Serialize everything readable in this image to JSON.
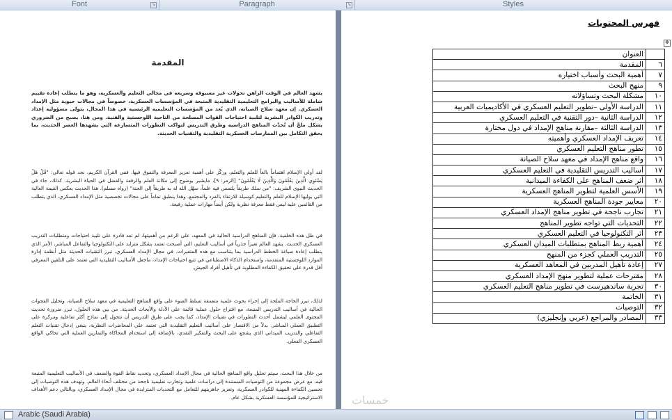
{
  "ribbon": {
    "groups": [
      "Font",
      "Paragraph",
      "Styles"
    ]
  },
  "document": {
    "title": "المقدمة",
    "paragraphs": [
      "يشهد العالم في الوقت الراهن تحولات غير مسبوقة وسريعة في مجالي التعليم والعسكرية، وهو ما يتطلب إعادة تقييم شاملة للأساليب والبرامج التعليمية التقليدية المتبعة في المؤسسات العسكرية، خصوصاً في مجالات حيوية مثل الإمداد العسكري. إن معهد سلاح الصيانة، الذي يُعد من المؤسسات التعليمية الرئيسية في هذا المجال، يتولى مسؤولية إعداد وتدريب الكوادر البشرية لتلبية احتياجات القوات المسلحة من الناحية اللوجستية والفنية. ومن هنا، يصبح من الضروري بشكل ملحّ أن تُحدّث المناهج الدراسية وطرق التدريس لتواكب التطورات المتسارعة التي يشهدها العصر الحديث، بما يحقق التكامل بين الممارسات العسكرية التقليدية والتقنيات الحديثة.",
      "لقد أولى الإسلام اهتماماً بالغاً للعلم والتعلم، وركّز على أهمية تعزيز المعرفة والتفوق فيها. ففي القرآن الكريم، نجد قوله تعالى: \"قُلْ هَلْ يَسْتَوِي الَّذِينَ يَعْلَمُونَ وَالَّذِينَ لَا يَعْلَمُونَ\" [الزمر: ٩]، مايشير بوضوح إلى مكانة العلم والرفعة والفضل في الحياة البشرية. كذلك، جاء في الحديث النبوي الشريف: \"من سلك طريقاً يلتمس فيه علماً، سهّل الله له به طريقاً إلى الجنة\" (رواه مسلم). هذا الحديث يعكس القيمة العالية التي يوليها الإسلام للعلم والتعليم كوسيلة للارتقاء بالفرد والمجتمع. وهذا ينطبق تماماً على مجالات تخصصية مثل الإمداد العسكري، الذي يتطلب من القائمين عليه ليس فقط معرفة نظرية ولكن أيضاً مهارات عملية رفيعة.",
      "في ظل هذه الخلفية، فإن المناهج الدراسية الحالية في المعهد، على الرغم من أهميتها، لم تعد قادرة على تلبية احتياجات ومتطلبات التدريب العسكري الحديث. يشهد العالم تغيراً جذرياً في أساليب التعليم، التي أصبحت تعتمد بشكل متزايد على التكنولوجيا والتفاعل المباشر، الأمر الذي يتطلب إعادة صياغة الخطط الدراسية بما يتناسب مع هذه المتغيرات. في مجال الإمداد العسكري، تبرز التقنيات الحديثة مثل أنظمة إدارة الموارد اللوجستية المتقدمة، واستخدام الذكاء الاصطناعي في تتبع احتياجات الإمداد، ماجعل الأساليب التقليدية التي تعتمد على التلقين المعرفي أقل قدرة على تحقيق الكفاءة المطلوبة في تأهيل أفراد الجيش.",
      "لذلك، تبرز الحاجة الملحة إلى إجراء بحوث علمية متعمقة تسلط الضوء على واقع المناهج التعليمية في معهد سلاح الصيانة، وتحليل الفجوات الحالية في أساليب التدريس المتبعة، مع اقتراح حلول عملية قائمة على الأدلة والأبحاث الحديثة. من بين هذه الحلول، تبرز ضرورة تحديث المحتوى العلمي ليشمل أحدث التطورات في تقنيات الإمداد، كما يجب على طرق التدريس أن تتحول إلى نماذج أكثر تفاعلية ومركزة على التطبيق العملي المباشر. بدلاً من الاقتصار على أساليب التعليم التقليدية التي تعتمد على المحاضرات النظرية، ينبغي إدخال تقنيات التعلم التفاعلي والتدريب الميداني الذي يشجع على البحث والتفكير النقدي، بالإضافة إلى استخدام المحاكاة والتمارين العملية التي تحاكي الواقع العسكري الفعلي.",
      "من خلال هذا البحث، سيتم تحليل واقع المناهج الحالية في مجال الإمداد العسكري، وتحديد نقاط القوة والضعف في الأساليب التعليمية المتبعة فيه، مع عرض مجموعة من التوصيات المستندة إلى دراسات علمية وتجارب تعليمية ناجحة من مختلف أنحاء العالم. وتهدف هذه التوصيات إلى تحسين الكفاءة المهنية للكوادر العسكرية، وتعزيز جاهزيتهم للتعامل مع التحديات المتزايدة في مجال الإمداد العسكري، وبالتالي دعم الأهداف الاستراتيجية للمؤسسة العسكرية بشكل عام."
    ]
  },
  "toc": {
    "heading": "فهرس المحتويات",
    "move_handle": "✥",
    "rows": [
      {
        "num": "",
        "title": "العنوان"
      },
      {
        "num": "٦",
        "title": "المقدمة"
      },
      {
        "num": "٧",
        "title": "أهمية البحث وأسباب اختياره"
      },
      {
        "num": "٩",
        "title": "منهج البحث"
      },
      {
        "num": "١٠",
        "title": "مشكلة البحث وتساؤلاته"
      },
      {
        "num": "١١",
        "title": "الدراسة الأولى –تطوير التعليم العسكري في الأكاديميات العربية"
      },
      {
        "num": "١٢",
        "title": "الدراسة الثانية –دور التقنية في التعليم العسكري"
      },
      {
        "num": "١٣",
        "title": "الدراسة الثالثة –مقارنة مناهج الإمداد في دول مختارة"
      },
      {
        "num": "١٤",
        "title": "تعريف الإمداد العسكري وأهميته"
      },
      {
        "num": "١٥",
        "title": "تطور مناهج التعليم العسكري"
      },
      {
        "num": "١٦",
        "title": "واقع مناهج الإمداد في معهد سلاح الصيانة"
      },
      {
        "num": "١٧",
        "title": "أساليب التدريس التقليدية في التعليم العسكري"
      },
      {
        "num": "١٨",
        "title": "أثر ضعف المناهج على الكفاءة الميدانية"
      },
      {
        "num": "١٩",
        "title": "الأسس العلمية لتطوير المناهج العسكرية"
      },
      {
        "num": "٢٠",
        "title": "معايير جودة المناهج العسكرية"
      },
      {
        "num": "٢١",
        "title": "تجارب ناجحة في تطوير مناهج الإمداد العسكري"
      },
      {
        "num": "٢٢",
        "title": "التحديات التي تواجه تطوير المناهج"
      },
      {
        "num": "٢٣",
        "title": "أثر التكنولوجيا في التعليم العسكري"
      },
      {
        "num": "٢٤",
        "title": "أهمية ربط المناهج بمتطلبات الميدان العسكري"
      },
      {
        "num": "٢٥",
        "title": "التدريب العملي كجزء من المنهج"
      },
      {
        "num": "٢٧",
        "title": "إعادة تأهيل المدربين في المعاهد العسكرية"
      },
      {
        "num": "٢٨",
        "title": "مقترحات عملية لتطوير منهج الإمداد العسكري"
      },
      {
        "num": "٣٠",
        "title": "تجربة ساندهيرست في تطوير مناهج التعليم العسكري"
      },
      {
        "num": "٣١",
        "title": "الخاتمة"
      },
      {
        "num": "٣٢",
        "title": "التوصيات"
      },
      {
        "num": "٣٣",
        "title": "المصادر والمراجع (عربي وإنجليزي)"
      }
    ]
  },
  "statusbar": {
    "language": "Arabic (Saudi Arabia)",
    "view_icons": [
      "print-layout-icon",
      "full-screen-reading-icon",
      "web-layout-icon"
    ]
  },
  "watermark": "خمسات"
}
